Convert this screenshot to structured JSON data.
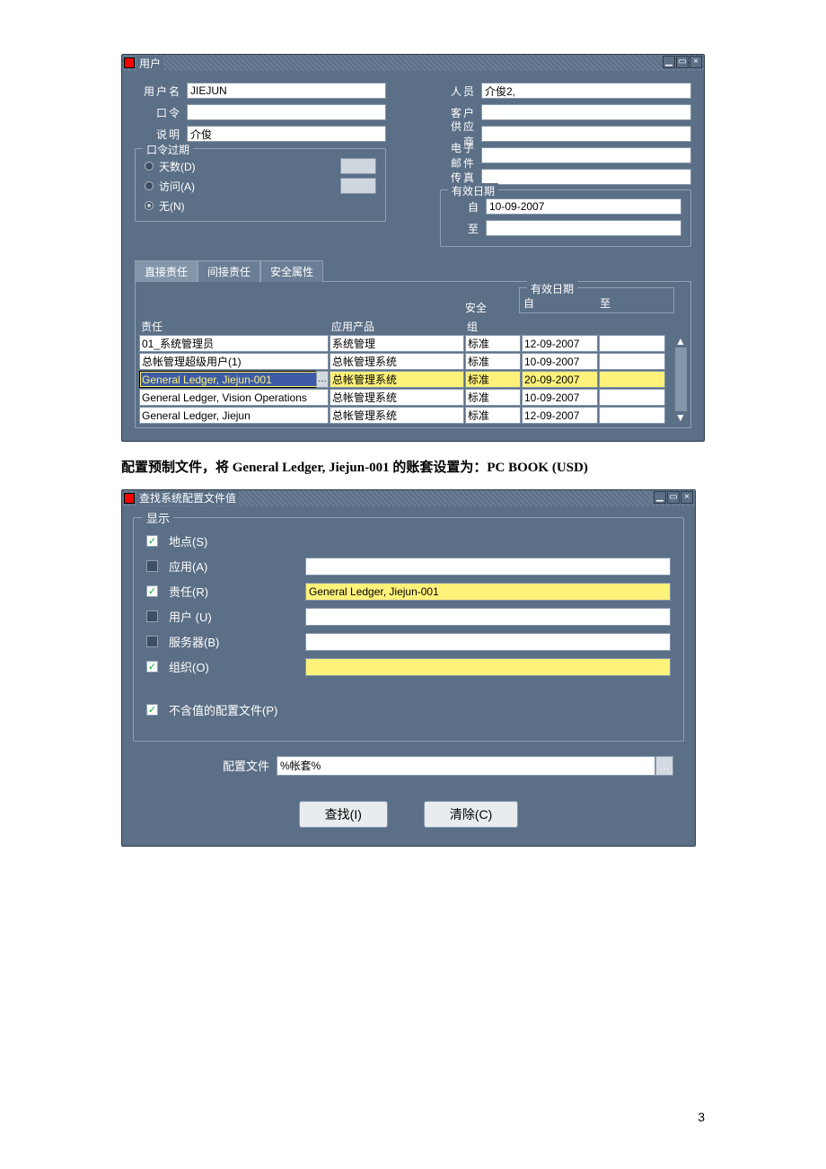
{
  "win1": {
    "title": "用户",
    "fields": {
      "username_label": "用户名",
      "username": "JIEJUN",
      "password_label": "口令",
      "desc_label": "说明",
      "desc": "介俊",
      "person_label": "人员",
      "person": "介俊2,",
      "customer_label": "客户",
      "supplier_label": "供应商",
      "email_label": "电子邮件",
      "fax_label": "传真"
    },
    "pw_expire": {
      "legend": "口令过期",
      "days": "天数(D)",
      "visits": "访问(A)",
      "none": "无(N)"
    },
    "effective": {
      "legend": "有效日期",
      "from_label": "自",
      "from": "10-09-2007",
      "to_label": "至"
    },
    "tabs": {
      "direct": "直接责任",
      "indirect": "间接责任",
      "security": "安全属性"
    },
    "tbl": {
      "hdr": {
        "resp": "责任",
        "app": "应用产品",
        "sec_top": "安全",
        "sec": "组",
        "eff_legend": "有效日期",
        "from": "自",
        "to": "至"
      },
      "rows": [
        {
          "resp": "01_系统管理员",
          "app": "系统管理",
          "sec": "标准",
          "from": "12-09-2007",
          "to": ""
        },
        {
          "resp": "总帐管理超级用户(1)",
          "app": "总帐管理系统",
          "sec": "标准",
          "from": "10-09-2007",
          "to": ""
        },
        {
          "resp": "General Ledger, Jiejun-001",
          "app": "总帐管理系统",
          "sec": "标准",
          "from": "20-09-2007",
          "to": ""
        },
        {
          "resp": "General Ledger, Vision Operations",
          "app": "总帐管理系统",
          "sec": "标准",
          "from": "10-09-2007",
          "to": ""
        },
        {
          "resp": "General Ledger, Jiejun",
          "app": "总帐管理系统",
          "sec": "标准",
          "from": "12-09-2007",
          "to": ""
        }
      ]
    }
  },
  "article": "配置预制文件，将 General Ledger, Jiejun-001 的账套设置为：PC BOOK (USD)",
  "win2": {
    "title": "查找系统配置文件值",
    "display_legend": "显示",
    "rows": {
      "site": "地点(S)",
      "app": "应用(A)",
      "resp": "责任(R)",
      "resp_val": "General Ledger, Jiejun-001",
      "user": "用户 (U)",
      "server": "服务器(B)",
      "org": "组织(O)",
      "novalue": "不含值的配置文件(P)"
    },
    "profile_label": "配置文件",
    "profile_value": "%帐套%",
    "find_btn": "查找(I)",
    "clear_btn": "清除(C)"
  },
  "page_number": "3"
}
